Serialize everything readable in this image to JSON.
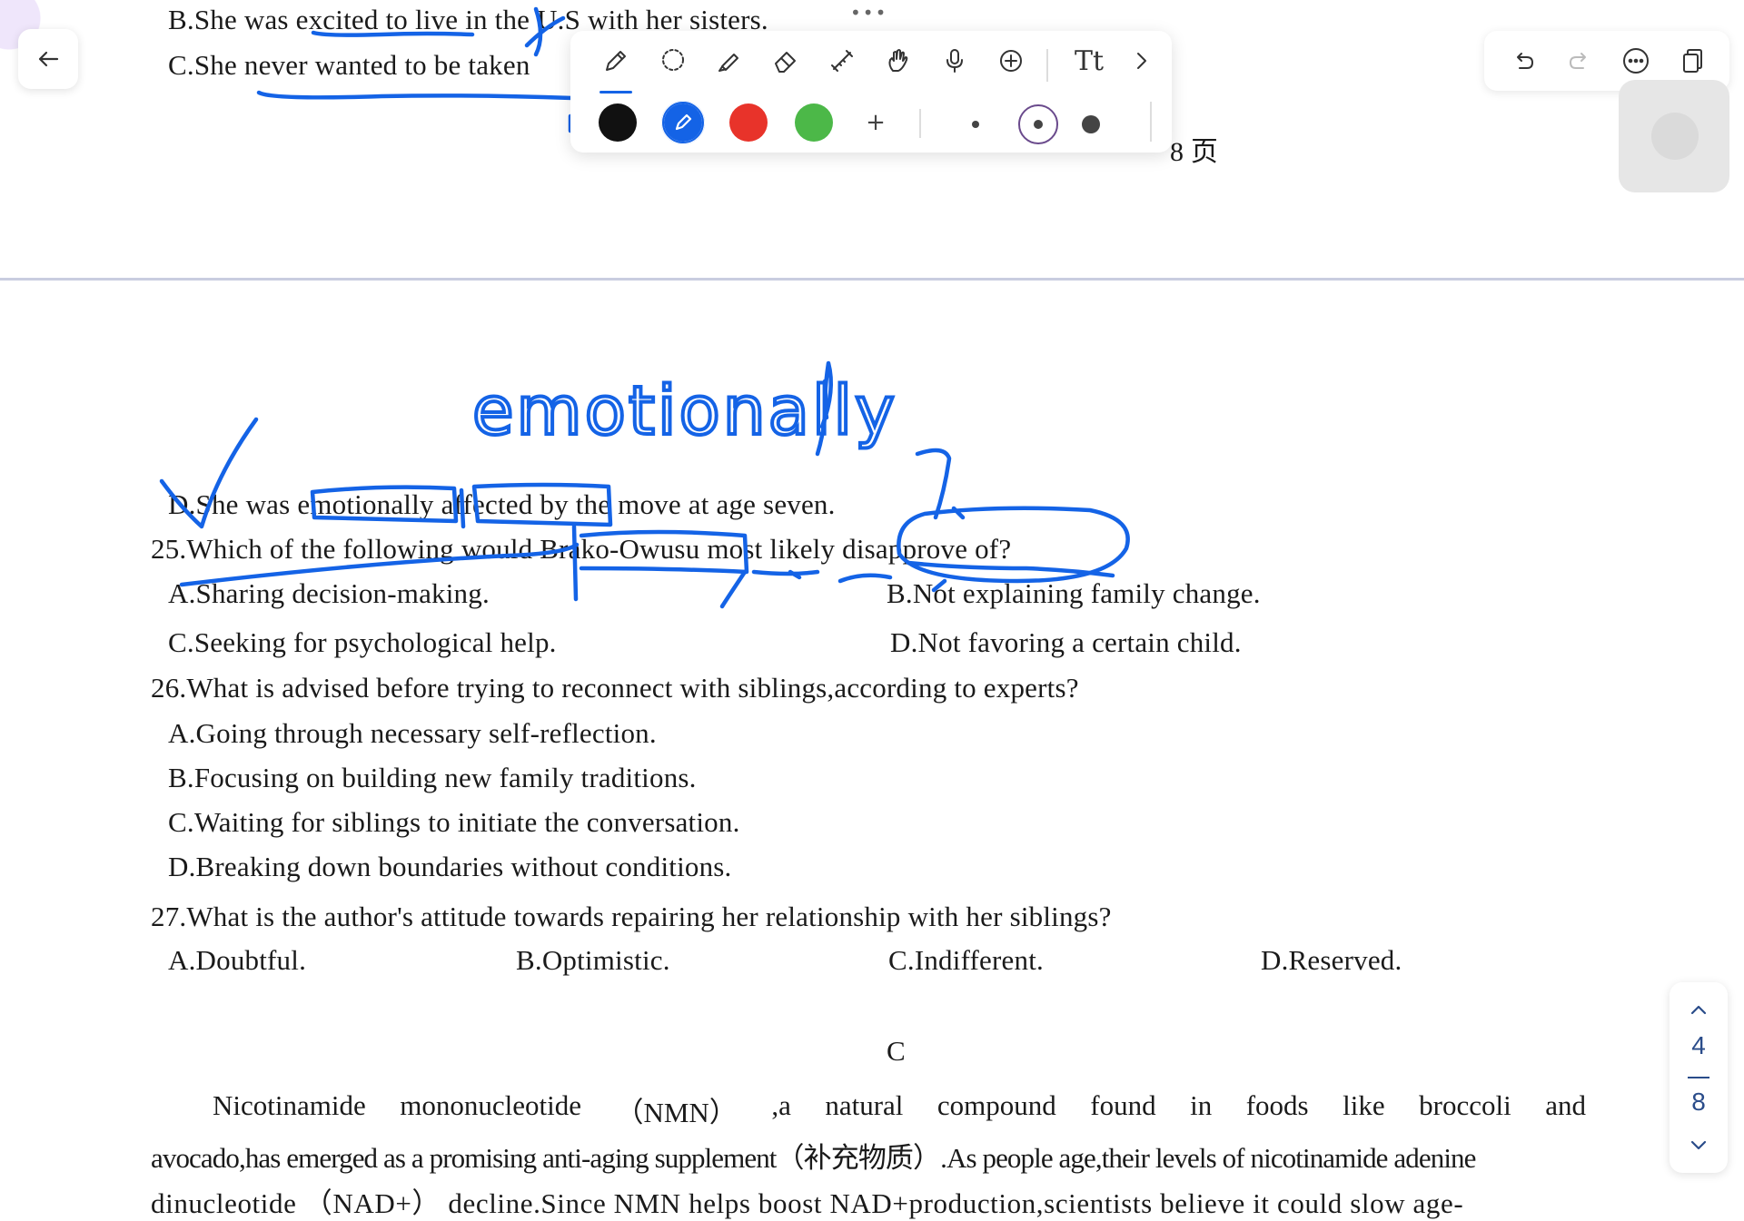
{
  "document": {
    "top_page": {
      "option_b_prev": "B.She was excited to live in the U.S with her sisters.",
      "option_c_prev": "C.She never wanted to be taken",
      "page_footer": "8 页"
    },
    "q24_option_d": "D.She was emotionally affected by the move at age seven.",
    "q25": {
      "question": "25.Which of the following would Brako-Owusu most likely disapprove of?",
      "a": "A.Sharing  decision-making.",
      "b": "B.Not explaining family change.",
      "c": "C.Seeking for psychological help.",
      "d": "D.Not favoring a certain child."
    },
    "q26": {
      "question": "26.What is advised before trying to reconnect with siblings,according to experts?",
      "a": "A.Going through necessary self-reflection.",
      "b": "B.Focusing on building new family traditions.",
      "c": "C.Waiting for siblings to initiate the conversation.",
      "d": "D.Breaking down boundaries without conditions."
    },
    "q27": {
      "question": "27.What is the author's attitude towards repairing her relationship with her siblings?",
      "a": "A.Doubtful.",
      "b": "B.Optimistic.",
      "c": "C.Indifferent.",
      "d": "D.Reserved."
    },
    "section_heading": "C",
    "passage": {
      "line1": [
        "Nicotinamide",
        "mononucleotide",
        "（NMN）",
        ",a",
        "natural",
        "compound",
        "found",
        "in",
        "foods",
        "like",
        "broccoli",
        "and"
      ],
      "line2": "avocado,has emerged as a promising anti-aging supplement（补充物质）.As people age,their levels of nicotinamide adenine",
      "line3": "dinucleotide （NAD+） decline.Since NMN helps boost NAD+production,scientists believe it could slow age-"
    }
  },
  "handwriting": {
    "word": "emotionally"
  },
  "toolbar": {
    "dots": "•••",
    "tools": [
      "pen-icon",
      "lasso-icon",
      "highlighter-icon",
      "eraser-icon",
      "tape-icon",
      "hand-icon",
      "microphone-icon",
      "add-icon",
      "text-style-icon",
      "chevron-right-icon"
    ],
    "text_style_label": "Tt",
    "add_color_label": "+",
    "colors": [
      "#000000",
      "#1463e6",
      "#e8332a",
      "#4cb848"
    ],
    "selected_color": "#1463e6",
    "selected_size": "medium"
  },
  "right_toolbar": {
    "tools": [
      "undo-icon",
      "redo-icon",
      "more-icon",
      "pages-icon"
    ]
  },
  "pager": {
    "current_page": "4",
    "total_pages": "8"
  }
}
